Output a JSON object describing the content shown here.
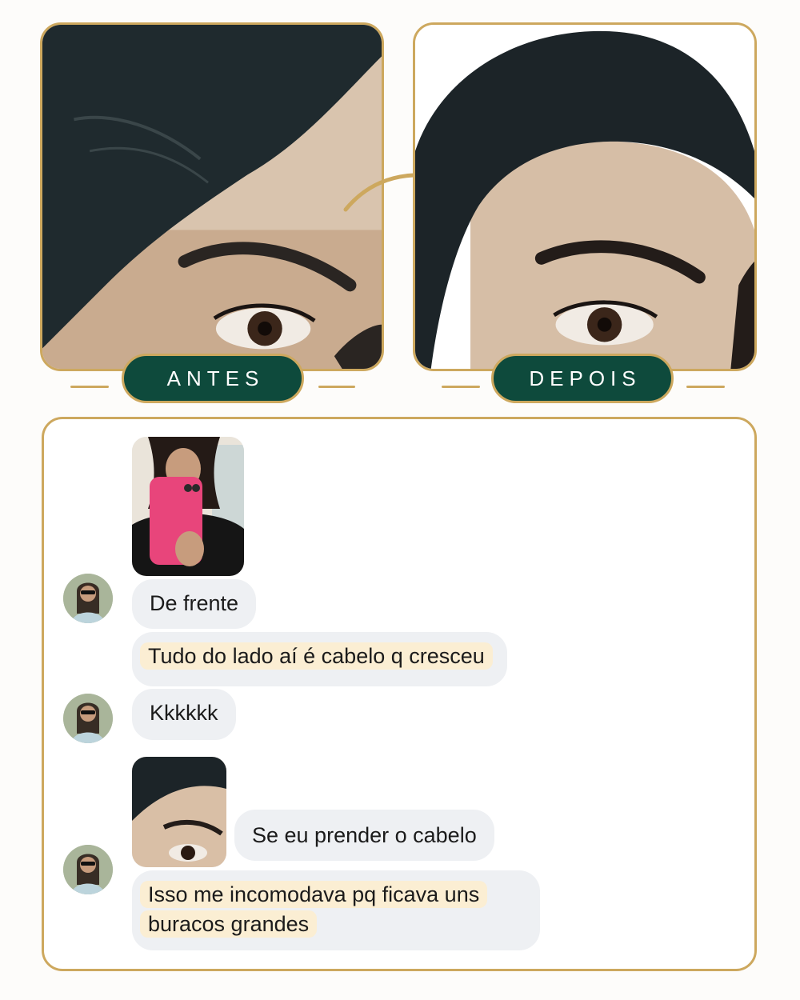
{
  "before_after": {
    "before_label": "ANTES",
    "after_label": "DEPOIS"
  },
  "chat": {
    "messages": [
      {
        "kind": "photo",
        "icon": "selfie-mirror-photo"
      },
      {
        "kind": "text",
        "text": "De frente"
      },
      {
        "kind": "text",
        "text": "Tudo do lado aí é cabelo q cresceu",
        "highlighted": true
      },
      {
        "kind": "text",
        "text": "Kkkkkk"
      },
      {
        "kind": "photo",
        "icon": "hairline-closeup-photo"
      },
      {
        "kind": "text",
        "text": "Se eu prender o cabelo"
      },
      {
        "kind": "text",
        "text": "Isso me incomodava pq ficava uns buracos grandes",
        "highlighted": true
      }
    ]
  },
  "colors": {
    "gold": "#cda85e",
    "pill_green": "#0e4a3c",
    "bubble_grey": "#eef0f3",
    "highlight": "#fbeed3"
  }
}
